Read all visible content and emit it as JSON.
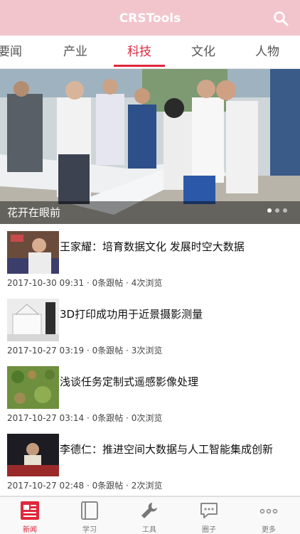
{
  "app": {
    "title": "CRSTools",
    "accent": "#e0283c",
    "header_color": "#f2c5cc"
  },
  "tabs": [
    {
      "label": "要闻",
      "active": false
    },
    {
      "label": "产业",
      "active": false
    },
    {
      "label": "科技",
      "active": true
    },
    {
      "label": "文化",
      "active": false
    },
    {
      "label": "人物",
      "active": false
    }
  ],
  "banner": {
    "caption": "花开在眼前",
    "slides": 3,
    "current": 1
  },
  "news": [
    {
      "title": "王家耀：培育数据文化  发展时空大数据",
      "date": "2017-10-30 09:31",
      "replies": "0条跟帖",
      "views": "4次浏览"
    },
    {
      "title": "3D打印成功用于近景摄影测量",
      "date": "2017-10-27 03:19",
      "replies": "0条跟帖",
      "views": "3次浏览"
    },
    {
      "title": "浅谈任务定制式遥感影像处理",
      "date": "2017-10-27 03:14",
      "replies": "0条跟帖",
      "views": "0次浏览"
    },
    {
      "title": "李德仁：推进空间大数据与人工智能集成创新",
      "date": "2017-10-27 02:48",
      "replies": "0条跟帖",
      "views": "2次浏览"
    }
  ],
  "bottom_nav": [
    {
      "label": "新闻",
      "icon": "newspaper-icon",
      "active": true
    },
    {
      "label": "学习",
      "icon": "book-icon",
      "active": false
    },
    {
      "label": "工具",
      "icon": "wrench-icon",
      "active": false
    },
    {
      "label": "圈子",
      "icon": "chat-bubble-icon",
      "active": false
    },
    {
      "label": "更多",
      "icon": "more-dots-icon",
      "active": false
    }
  ]
}
